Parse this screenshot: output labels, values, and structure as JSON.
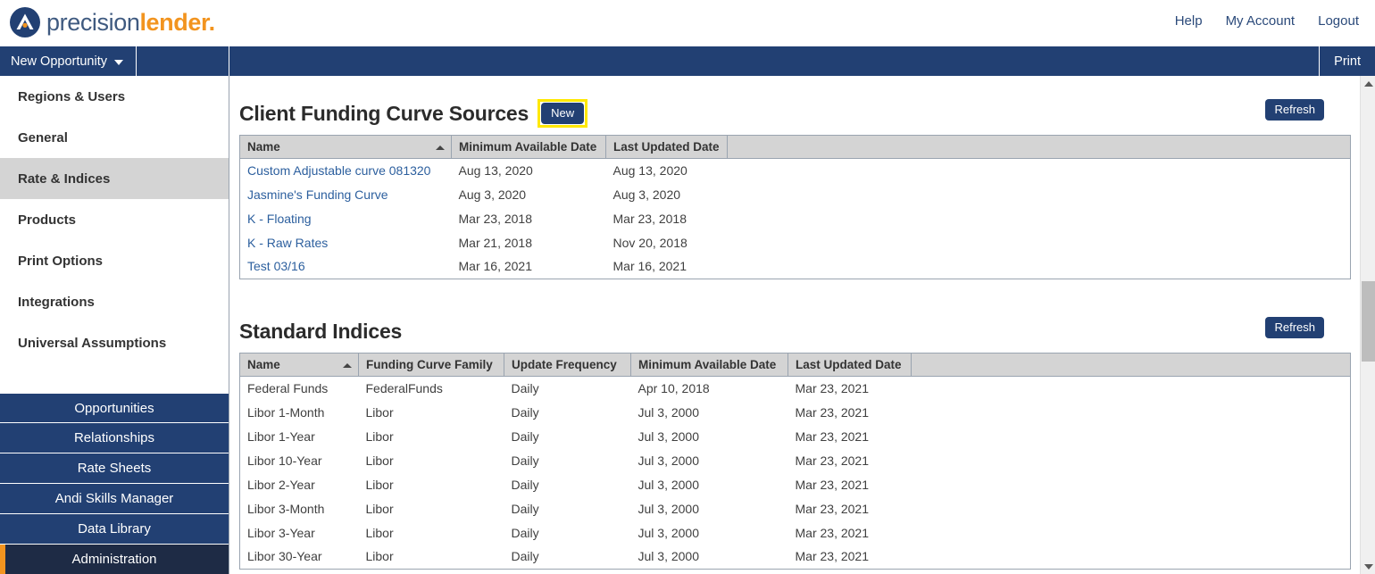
{
  "brand": {
    "logo_text_part1": "precision",
    "logo_text_part2": "lender",
    "logo_dot": ".",
    "logo_icon": "precisionlender-circle-chevron-icon",
    "navy": "#224073",
    "orange": "#f2941f",
    "link_blue": "#2c5f9e",
    "highlight_yellow": "#ffe800"
  },
  "header": {
    "links": [
      {
        "label": "Help"
      },
      {
        "label": "My Account"
      },
      {
        "label": "Logout"
      }
    ]
  },
  "menubar": {
    "new_opportunity": "New Opportunity",
    "caret_icon": "chevron-down-icon",
    "print": "Print"
  },
  "sidebar": {
    "items": [
      {
        "label": "Regions & Users",
        "active": false
      },
      {
        "label": "General",
        "active": false
      },
      {
        "label": "Rate & Indices",
        "active": true
      },
      {
        "label": "Products",
        "active": false
      },
      {
        "label": "Print Options",
        "active": false
      },
      {
        "label": "Integrations",
        "active": false
      },
      {
        "label": "Universal Assumptions",
        "active": false
      }
    ],
    "bottom_buttons": [
      {
        "label": "Opportunities",
        "current": false
      },
      {
        "label": "Relationships",
        "current": false
      },
      {
        "label": "Rate Sheets",
        "current": false
      },
      {
        "label": "Andi Skills Manager",
        "current": false
      },
      {
        "label": "Data Library",
        "current": false
      },
      {
        "label": "Administration",
        "current": true
      }
    ]
  },
  "sections": [
    {
      "id": "client_funding_curve_sources",
      "title": "Client Funding Curve Sources",
      "new_button": "New",
      "new_button_highlighted": true,
      "refresh_button": "Refresh",
      "columns": [
        {
          "label": "Name",
          "sorted": "asc",
          "sort_icon": "sort-ascending-icon"
        },
        {
          "label": "Minimum Available Date",
          "sorted": null
        },
        {
          "label": "Last Updated Date",
          "sorted": null
        },
        {
          "label": "",
          "sorted": null
        }
      ],
      "rows": [
        {
          "name": "Custom Adjustable curve 081320",
          "name_is_link": true,
          "minimum_available_date": "Aug 13, 2020",
          "last_updated_date": "Aug 13, 2020",
          "extra": ""
        },
        {
          "name": "Jasmine's Funding Curve",
          "name_is_link": true,
          "minimum_available_date": "Aug 3, 2020",
          "last_updated_date": "Aug 3, 2020",
          "extra": ""
        },
        {
          "name": "K - Floating",
          "name_is_link": true,
          "minimum_available_date": "Mar 23, 2018",
          "last_updated_date": "Mar 23, 2018",
          "extra": ""
        },
        {
          "name": "K - Raw Rates",
          "name_is_link": true,
          "minimum_available_date": "Mar 21, 2018",
          "last_updated_date": "Nov 20, 2018",
          "extra": ""
        },
        {
          "name": "Test 03/16",
          "name_is_link": true,
          "minimum_available_date": "Mar 16, 2021",
          "last_updated_date": "Mar 16, 2021",
          "extra": ""
        }
      ]
    },
    {
      "id": "standard_indices",
      "title": "Standard Indices",
      "refresh_button": "Refresh",
      "columns": [
        {
          "label": "Name",
          "sorted": "asc",
          "sort_icon": "sort-ascending-icon"
        },
        {
          "label": "Funding Curve Family",
          "sorted": null
        },
        {
          "label": "Update Frequency",
          "sorted": null
        },
        {
          "label": "Minimum Available Date",
          "sorted": null
        },
        {
          "label": "Last Updated Date",
          "sorted": null
        },
        {
          "label": "",
          "sorted": null
        }
      ],
      "rows": [
        {
          "name": "Federal Funds",
          "funding_curve_family": "FederalFunds",
          "update_frequency": "Daily",
          "minimum_available_date": "Apr 10, 2018",
          "last_updated_date": "Mar 23, 2021",
          "extra": ""
        },
        {
          "name": "Libor 1-Month",
          "funding_curve_family": "Libor",
          "update_frequency": "Daily",
          "minimum_available_date": "Jul 3, 2000",
          "last_updated_date": "Mar 23, 2021",
          "extra": ""
        },
        {
          "name": "Libor 1-Year",
          "funding_curve_family": "Libor",
          "update_frequency": "Daily",
          "minimum_available_date": "Jul 3, 2000",
          "last_updated_date": "Mar 23, 2021",
          "extra": ""
        },
        {
          "name": "Libor 10-Year",
          "funding_curve_family": "Libor",
          "update_frequency": "Daily",
          "minimum_available_date": "Jul 3, 2000",
          "last_updated_date": "Mar 23, 2021",
          "extra": ""
        },
        {
          "name": "Libor 2-Year",
          "funding_curve_family": "Libor",
          "update_frequency": "Daily",
          "minimum_available_date": "Jul 3, 2000",
          "last_updated_date": "Mar 23, 2021",
          "extra": ""
        },
        {
          "name": "Libor 3-Month",
          "funding_curve_family": "Libor",
          "update_frequency": "Daily",
          "minimum_available_date": "Jul 3, 2000",
          "last_updated_date": "Mar 23, 2021",
          "extra": ""
        },
        {
          "name": "Libor 3-Year",
          "funding_curve_family": "Libor",
          "update_frequency": "Daily",
          "minimum_available_date": "Jul 3, 2000",
          "last_updated_date": "Mar 23, 2021",
          "extra": ""
        },
        {
          "name": "Libor 30-Year",
          "funding_curve_family": "Libor",
          "update_frequency": "Daily",
          "minimum_available_date": "Jul 3, 2000",
          "last_updated_date": "Mar 23, 2021",
          "extra": ""
        }
      ]
    }
  ],
  "scrollbar": {
    "up_icon": "scroll-up-arrow-icon",
    "down_icon": "scroll-down-arrow-icon"
  }
}
